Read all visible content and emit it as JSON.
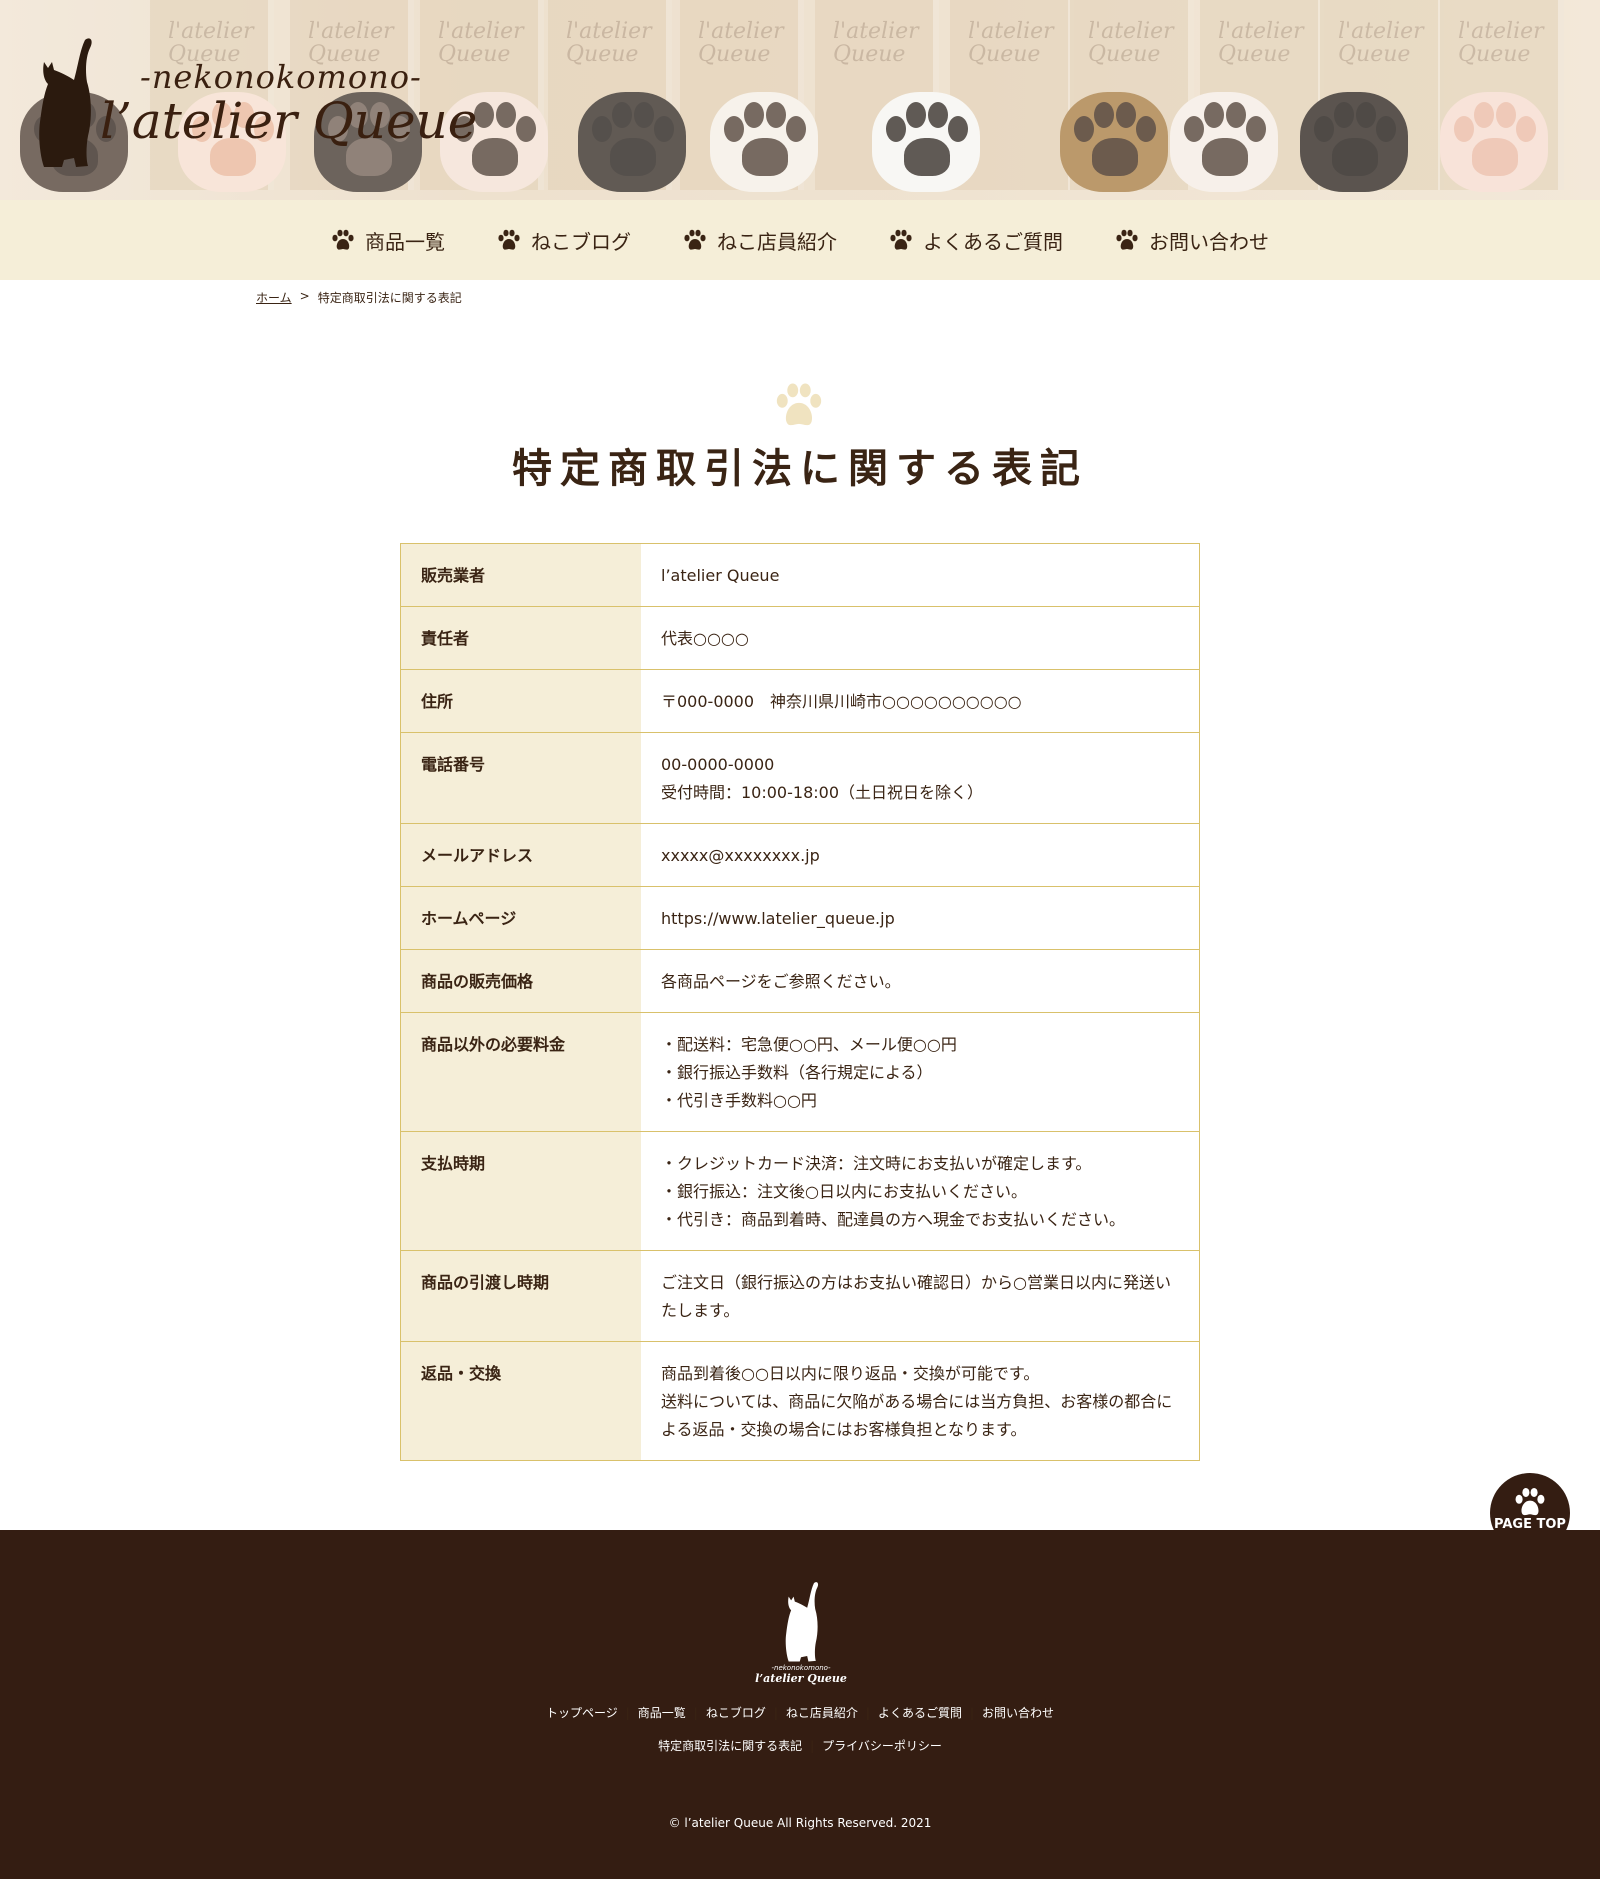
{
  "header": {
    "logo_sub": "-nekonokomono-",
    "logo_name": "l’atelier Queue",
    "banner_tag_text": "l'atelier Queue"
  },
  "nav": {
    "items": [
      {
        "label": "商品一覧"
      },
      {
        "label": "ねこブログ"
      },
      {
        "label": "ねこ店員紹介"
      },
      {
        "label": "よくあるご質問"
      },
      {
        "label": "お問い合わせ"
      }
    ]
  },
  "breadcrumb": {
    "home": "ホーム",
    "separator": ">",
    "current": "特定商取引法に関する表記"
  },
  "page": {
    "title": "特定商取引法に関する表記"
  },
  "table": {
    "rows": [
      {
        "label": "販売業者",
        "lines": [
          "l’atelier Queue"
        ]
      },
      {
        "label": "責任者",
        "lines": [
          "代表○○○○"
        ]
      },
      {
        "label": "住所",
        "lines": [
          "〒000-0000　神奈川県川崎市○○○○○○○○○○"
        ]
      },
      {
        "label": "電話番号",
        "lines": [
          "00-0000-0000",
          "受付時間：10:00-18:00（土日祝日を除く）"
        ]
      },
      {
        "label": "メールアドレス",
        "lines": [
          "xxxxx@xxxxxxxx.jp"
        ]
      },
      {
        "label": "ホームページ",
        "lines": [
          "https://www.latelier_queue.jp"
        ]
      },
      {
        "label": "商品の販売価格",
        "lines": [
          "各商品ページをご参照ください。"
        ]
      },
      {
        "label": "商品以外の必要料金",
        "lines": [
          "・配送料：宅急便○○円、メール便○○円",
          "・銀行振込手数料（各行規定による）",
          "・代引き手数料○○円"
        ]
      },
      {
        "label": "支払時期",
        "lines": [
          "・クレジットカード決済：注文時にお支払いが確定します。",
          "・銀行振込：注文後○日以内にお支払いください。",
          "・代引き：商品到着時、配達員の方へ現金でお支払いください。"
        ]
      },
      {
        "label": "商品の引渡し時期",
        "lines": [
          "ご注文日（銀行振込の方はお支払い確認日）から○営業日以内に発送い",
          "たします。"
        ]
      },
      {
        "label": "返品・交換",
        "lines": [
          "商品到着後○○日以内に限り返品・交換が可能です。",
          "送料については、商品に欠陥がある場合には当方負担、お客様の都合に",
          "よる返品・交換の場合にはお客様負担となります。"
        ]
      }
    ]
  },
  "pagetop": {
    "label": "PAGE TOP"
  },
  "footer": {
    "logo_sub": "-nekonokomono-",
    "logo_name": "l’atelier Queue",
    "links_row1": [
      "トップページ",
      "商品一覧",
      "ねこブログ",
      "ねこ店員紹介",
      "よくあるご質問",
      "お問い合わせ"
    ],
    "links_row2": [
      "特定商取引法に関する表記",
      "プライバシーポリシー"
    ],
    "separator": "|",
    "copyright": "© l’atelier Queue All Rights Reserved. 2021"
  },
  "colors": {
    "brand_dark": "#341d12",
    "nav_bg": "#f5eed8",
    "table_border": "#d9c16b",
    "title_paw": "#f0e3c0"
  },
  "icons": {
    "nav": "paw-icon",
    "logo": "cat-silhouette-icon",
    "pagetop": "paw-icon"
  }
}
